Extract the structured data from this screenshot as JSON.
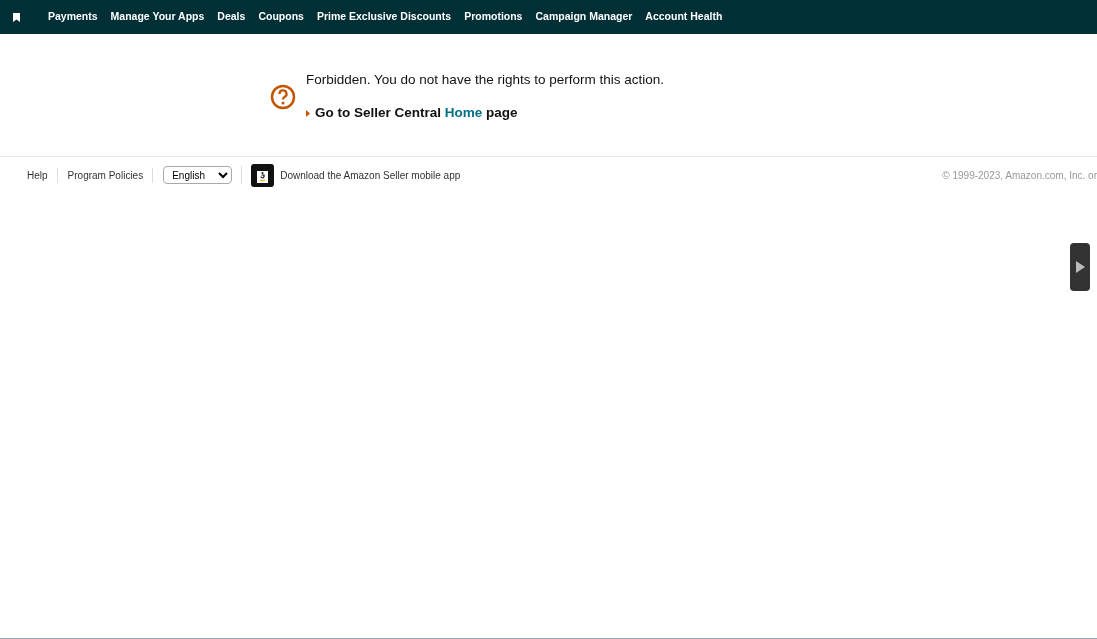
{
  "nav": {
    "items": [
      "Payments",
      "Manage Your Apps",
      "Deals",
      "Coupons",
      "Prime Exclusive Discounts",
      "Promotions",
      "Campaign Manager",
      "Account Health"
    ]
  },
  "message": {
    "text": "Forbidden. You do not have the rights to perform this action.",
    "link_prefix": "Go to Seller Central",
    "link": "Home",
    "link_suffix": "page"
  },
  "footer": {
    "links": [
      "Help",
      "Program Policies"
    ],
    "language": "English",
    "app_text": "Download the Amazon Seller mobile app",
    "copyright": "© 1999-2023, Amazon.com, Inc. or"
  }
}
